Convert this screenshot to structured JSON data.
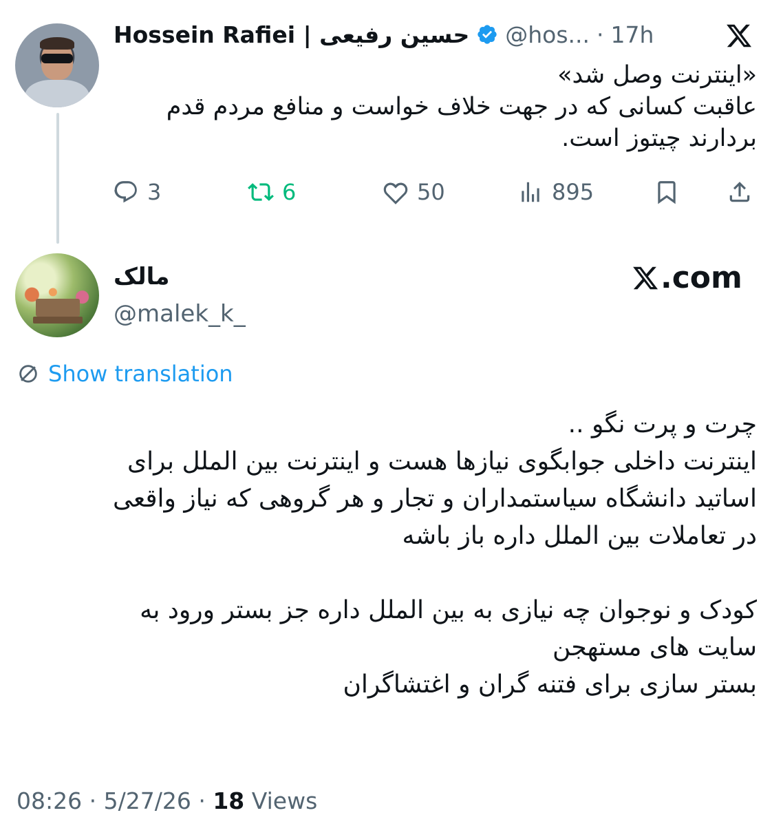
{
  "parent_tweet": {
    "display_name": "Hossein Rafiei | حسین رفیعی",
    "handle": "@hos...",
    "separator": "·",
    "time": "17h",
    "text_lines": [
      "«اینترنت وصل شد»",
      "عاقبت کسانی که در جهت خلاف خواست و منافع مردم قدم",
      "بردارند چیتوز است."
    ],
    "replies": "3",
    "retweets": "6",
    "likes": "50",
    "views": "895",
    "colors": {
      "retweet": "#00ba7c",
      "verified": "#1d9bf0",
      "muted": "#536471"
    },
    "icons": [
      "x-logo-icon",
      "verified-badge-icon",
      "reply-icon",
      "retweet-icon",
      "like-icon",
      "views-icon",
      "bookmark-icon",
      "share-icon"
    ]
  },
  "reply_tweet": {
    "display_name": "مالک",
    "handle": "@malek_k_",
    "site_label": ".com",
    "show_translation": "Show translation",
    "text_lines": [
      "چرت و پرت نگو ..",
      "اینترنت داخلی جوابگوی نیازها هست و اینترنت بین الملل برای",
      "اساتید دانشگاه سیاستمداران و تجار و هر گروهی که نیاز واقعی",
      "در تعاملات بین الملل داره باز باشه",
      "",
      "کودک و نوجوان چه نیازی به بین الملل داره جز بستر ورود به",
      "سایت های مستهجن",
      "بستر سازی برای فتنه گران و اغتشاگران"
    ],
    "time": "08:26",
    "date": "5/27/26",
    "separator": "·",
    "views_count": "18",
    "views_label": "Views",
    "colors": {
      "link": "#1d9bf0"
    }
  }
}
